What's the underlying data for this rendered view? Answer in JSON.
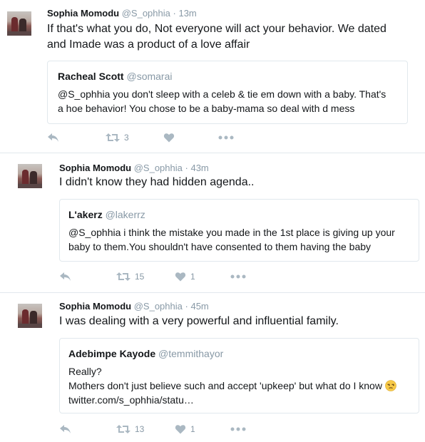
{
  "tweets": [
    {
      "name": "Sophia Momodu",
      "handle": "@S_ophhia",
      "separator": "·",
      "time": "13m",
      "text_line1": "If that's what you do, Not everyone will act your behavior. We dated",
      "text_line2": "and Imade was a product of a love affair",
      "quote": {
        "name": "Racheal Scott",
        "handle": "@somarai",
        "line1": "@S_ophhia you don't sleep with a celeb & tie em down with a baby. That's",
        "line2": "a hoe behavior! You chose to be a baby-mama so deal with d mess"
      },
      "retweets": "3",
      "likes": ""
    },
    {
      "name": "Sophia Momodu",
      "handle": "@S_ophhia",
      "separator": "·",
      "time": "43m",
      "text_line1": "I didn't know they had hidden agenda..",
      "quote": {
        "name": "L'akerz",
        "handle": "@lakerrz",
        "line1": "@S_ophhia i think the mistake you made in the 1st place is giving up your",
        "line2": "baby to them.You shouldn't have consented to them having the baby"
      },
      "retweets": "15",
      "likes": "1"
    },
    {
      "name": "Sophia Momodu",
      "handle": "@S_ophhia",
      "separator": "·",
      "time": "45m",
      "text_line1": "I was dealing with a very powerful and influential family.",
      "quote": {
        "name": "Adebimpe Kayode",
        "handle": "@temmithayor",
        "line1": "Really?",
        "line2": "Mothers don't just believe such and accept 'upkeep' but what do I know",
        "line3": "twitter.com/s_ophhia/statu…"
      },
      "retweets": "13",
      "likes": "1"
    }
  ],
  "icons": {
    "reply": "reply-icon",
    "retweet": "retweet-icon",
    "like": "heart-icon",
    "more": "more-icon",
    "emoji": "unamused-face-emoji"
  },
  "colors": {
    "text": "#14171a",
    "secondary": "#8899a6",
    "icon": "#aab8c2",
    "border": "#e1e8ed"
  }
}
